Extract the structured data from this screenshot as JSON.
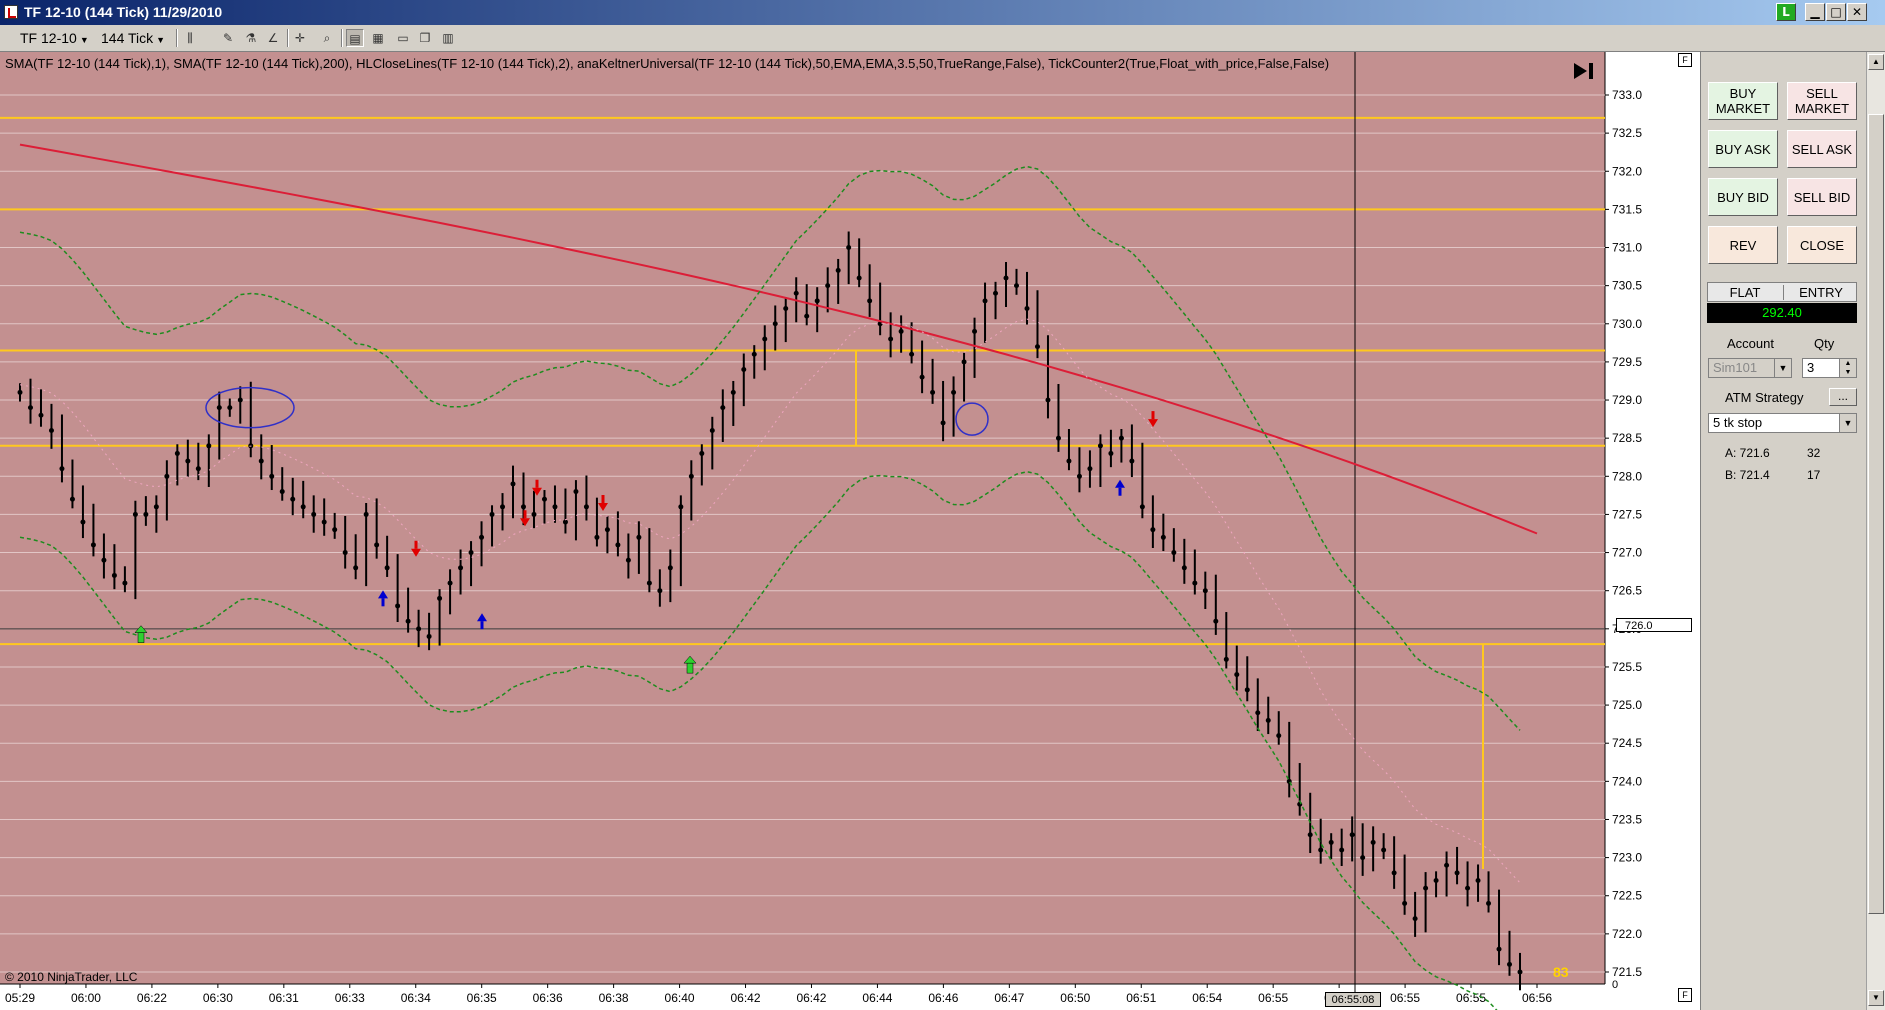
{
  "window": {
    "title": "TF 12-10 (144 Tick)  11/29/2010",
    "buttons": {
      "link": "L",
      "minimize": "▁",
      "maximize": "□",
      "close": "✕"
    }
  },
  "toolbar": {
    "instrument": "TF 12-10",
    "interval": "144 Tick"
  },
  "indicators_text": "SMA(TF  12-10  (144  Tick),1),  SMA(TF  12-10  (144  Tick),200),  HLCloseLines(TF  12-10  (144  Tick),2),  anaKeltnerUniversal(TF  12-10  (144  Tick),50,EMA,EMA,3.5,50,TrueRange,False),  TickCounter2(True,Float_with_price,False,False)",
  "copyright": "© 2010 NinjaTrader, LLC",
  "tick_counter": "83",
  "price_marker": "726.0",
  "time_marker": "06:55:08",
  "colors": {
    "chart_background": "#c39090",
    "hl_lines": "#ffc81e",
    "sma200": "#dc1e37",
    "keltner": "#1e8c1e",
    "price_bars": "#000000",
    "pnl_text": "#00ff00"
  },
  "chart_data": {
    "type": "ohlc",
    "y_axis": {
      "min": 721.5,
      "max": 733.0,
      "ticks": [
        "733.0",
        "732.5",
        "732.0",
        "731.5",
        "731.0",
        "730.5",
        "730.0",
        "729.5",
        "729.0",
        "728.5",
        "728.0",
        "727.5",
        "727.0",
        "726.5",
        "726.0",
        "725.5",
        "725.0",
        "724.5",
        "724.0",
        "723.5",
        "723.0",
        "722.5",
        "722.0",
        "721.5"
      ],
      "zero_label": "0"
    },
    "x_axis": {
      "labels": [
        "05:29",
        "06:00",
        "06:22",
        "06:30",
        "06:31",
        "06:33",
        "06:34",
        "06:35",
        "06:36",
        "06:38",
        "06:40",
        "06:42",
        "06:42",
        "06:44",
        "06:46",
        "06:47",
        "06:50",
        "06:51",
        "06:54",
        "06:55",
        "06:55",
        "06:55",
        "06:55",
        "06:56"
      ]
    },
    "horizontal_lines": [
      732.7,
      731.5,
      729.65,
      728.4,
      725.8
    ],
    "current_price_line": 726.0,
    "close": [
      729.1,
      728.9,
      728.8,
      728.6,
      728.1,
      727.7,
      727.4,
      727.1,
      726.9,
      726.7,
      726.6,
      727.5,
      727.5,
      727.6,
      728.0,
      728.3,
      728.2,
      728.1,
      728.4,
      728.9,
      728.9,
      729.0,
      728.4,
      728.2,
      728.0,
      727.8,
      727.7,
      727.6,
      727.5,
      727.4,
      727.3,
      727.0,
      726.8,
      727.5,
      727.1,
      726.8,
      726.3,
      726.1,
      726.0,
      725.9,
      726.4,
      726.6,
      726.8,
      727.0,
      727.2,
      727.5,
      727.6,
      727.9,
      727.6,
      727.5,
      727.7,
      727.6,
      727.4,
      727.8,
      727.6,
      727.2,
      727.3,
      727.1,
      726.9,
      727.2,
      726.6,
      726.5,
      726.8,
      727.6,
      728.0,
      728.3,
      728.6,
      728.9,
      729.1,
      729.4,
      729.6,
      729.8,
      730.0,
      730.2,
      730.4,
      730.1,
      730.3,
      730.5,
      730.7,
      731.0,
      730.6,
      730.3,
      730.0,
      729.8,
      729.9,
      729.6,
      729.3,
      729.1,
      728.7,
      729.1,
      729.5,
      729.9,
      730.3,
      730.4,
      730.6,
      730.5,
      730.2,
      729.7,
      729.0,
      728.5,
      728.2,
      728.0,
      728.1,
      728.4,
      728.3,
      728.5,
      728.2,
      727.6,
      727.3,
      727.2,
      727.0,
      726.8,
      726.6,
      726.5,
      726.1,
      725.6,
      725.4,
      725.2,
      724.9,
      724.8,
      724.6,
      724.0,
      723.7,
      723.3,
      723.1,
      723.2,
      723.1,
      723.3,
      723.0,
      723.2,
      723.1,
      722.8,
      722.4,
      722.2,
      722.6,
      722.7,
      722.9,
      722.8,
      722.6,
      722.7,
      722.4,
      721.8,
      721.6,
      721.5
    ]
  },
  "order_panel": {
    "buy_market": "BUY MARKET",
    "sell_market": "SELL MARKET",
    "buy_ask": "BUY ASK",
    "sell_ask": "SELL ASK",
    "buy_bid": "BUY BID",
    "sell_bid": "SELL BID",
    "rev": "REV",
    "close": "CLOSE",
    "position": "FLAT",
    "entry": "ENTRY",
    "pnl": "292.40",
    "account_label": "Account",
    "qty_label": "Qty",
    "account": "Sim101",
    "qty": "3",
    "atm_label": "ATM Strategy",
    "atm_ellipsis": "...",
    "atm_strategy": "5 tk stop",
    "ask_line": "A:  721.6",
    "ask_qty": "32",
    "bid_line": "B:  721.4",
    "bid_qty": "17"
  }
}
